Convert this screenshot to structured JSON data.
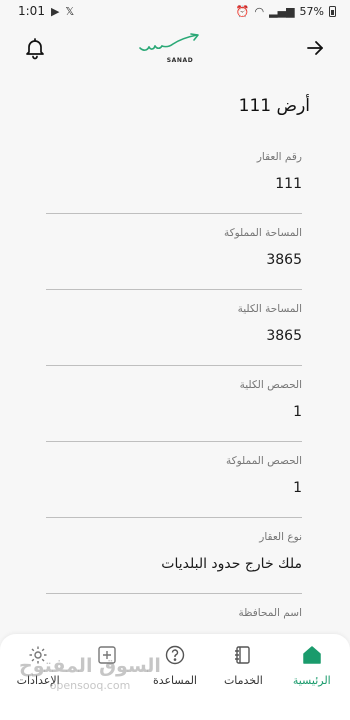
{
  "status_bar": {
    "time": "1:01",
    "battery": "57%"
  },
  "header": {
    "logo_text": "SANAD",
    "brand_color": "#2aa876"
  },
  "page": {
    "title": "أرض 111",
    "fields": [
      {
        "label": "رقم العقار",
        "value": "111"
      },
      {
        "label": "المساحة المملوكة",
        "value": "3865"
      },
      {
        "label": "المساحة الكلية",
        "value": "3865"
      },
      {
        "label": "الحصص الكلية",
        "value": "1"
      },
      {
        "label": "الحصص المملوكة",
        "value": "1"
      },
      {
        "label": "نوع العقار",
        "value": "ملك خارج حدود البلديات"
      },
      {
        "label": "اسم المحافظة",
        "value": ""
      }
    ]
  },
  "bottom_nav": {
    "active_color": "#1a9b6c",
    "items": [
      {
        "label": "الرئيسية",
        "icon": "home-icon",
        "active": true
      },
      {
        "label": "الخدمات",
        "icon": "services-icon",
        "active": false
      },
      {
        "label": "المساعدة",
        "icon": "help-icon",
        "active": false
      },
      {
        "label": "",
        "icon": "add-icon",
        "active": false
      },
      {
        "label": "الإعدادات",
        "icon": "settings-icon",
        "active": false
      }
    ]
  },
  "watermark": {
    "text_ar": "السوق المفتوح",
    "text_en": "opensooq.com"
  }
}
